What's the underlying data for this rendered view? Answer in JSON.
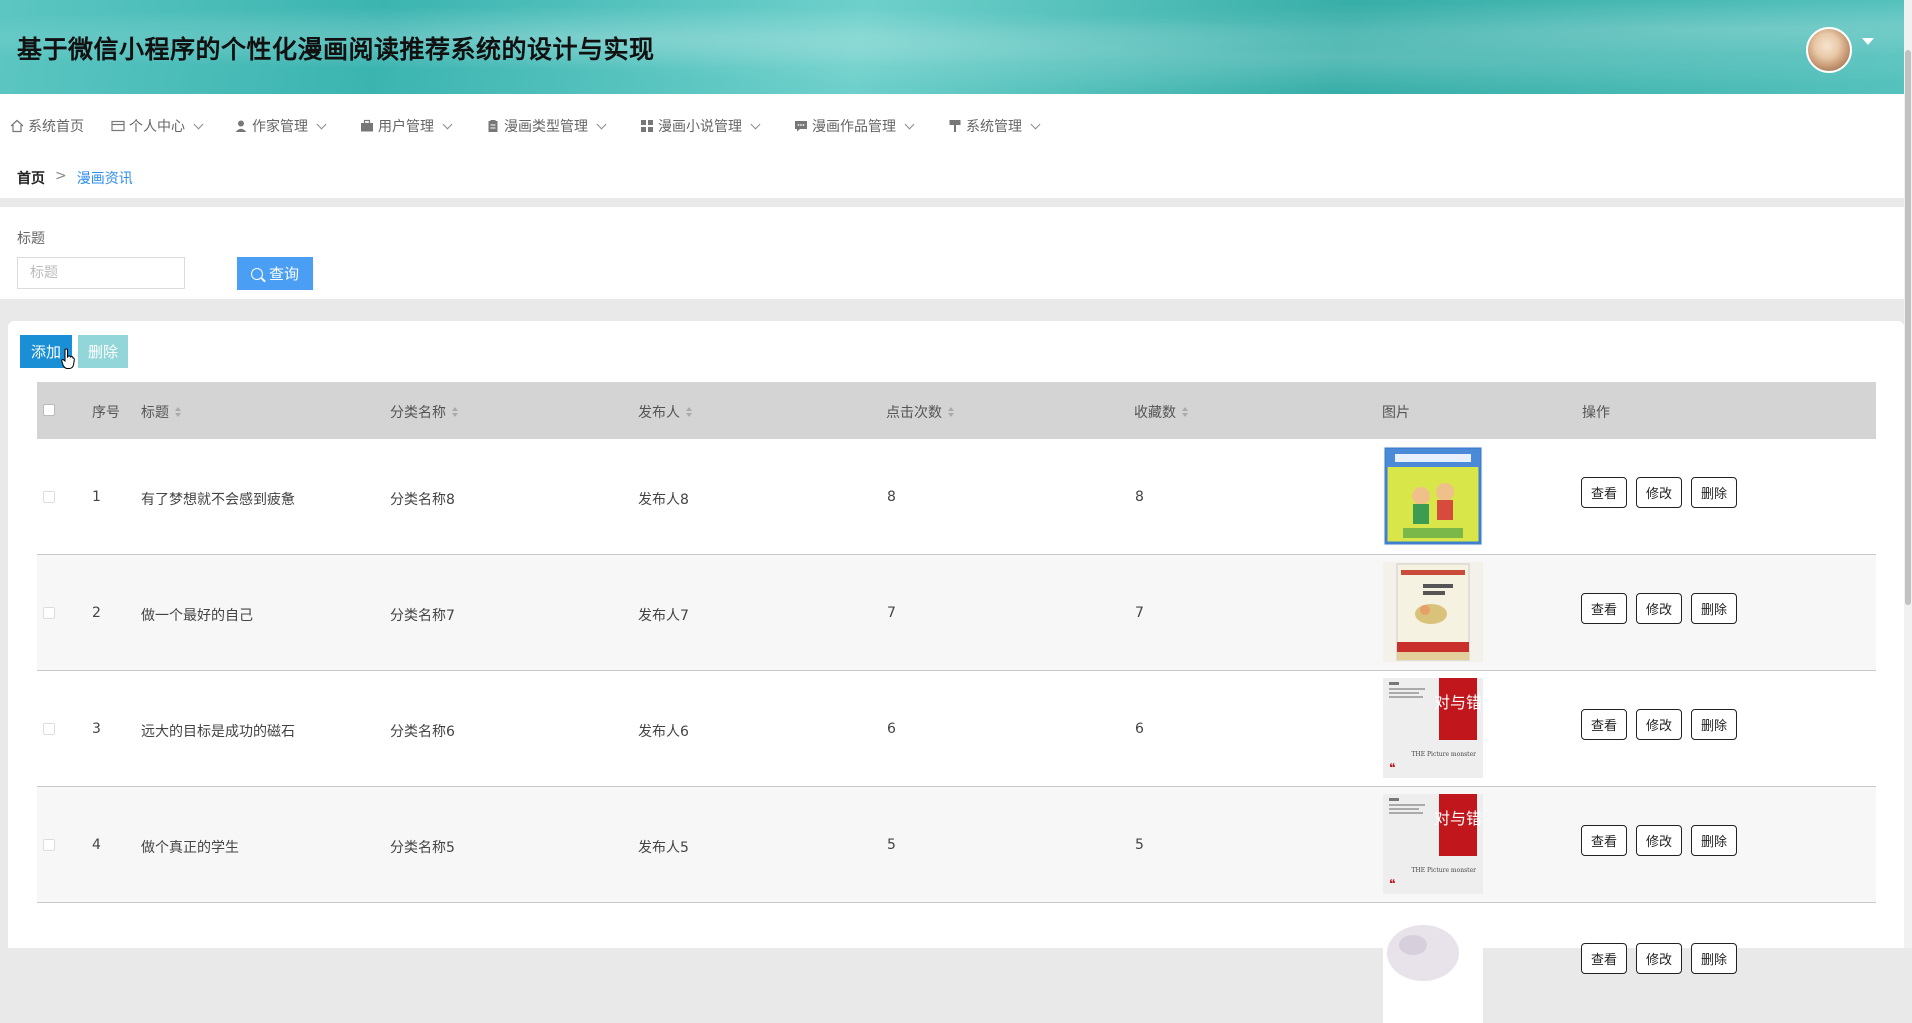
{
  "header": {
    "title": "基于微信小程序的个性化漫画阅读推荐系统的设计与实现"
  },
  "nav": {
    "items": [
      {
        "label": "系统首页",
        "icon": "home-icon"
      },
      {
        "label": "个人中心",
        "icon": "id-card-icon"
      },
      {
        "label": "作家管理",
        "icon": "user-icon"
      },
      {
        "label": "用户管理",
        "icon": "briefcase-icon"
      },
      {
        "label": "漫画类型管理",
        "icon": "clipboard-icon"
      },
      {
        "label": "漫画小说管理",
        "icon": "grid-icon"
      },
      {
        "label": "漫画作品管理",
        "icon": "chat-icon"
      },
      {
        "label": "系统管理",
        "icon": "paint-roller-icon"
      }
    ]
  },
  "breadcrumb": {
    "home": "首页",
    "sep": ">",
    "current": "漫画资讯"
  },
  "search": {
    "label": "标题",
    "placeholder": "标题",
    "button": "查询"
  },
  "toolbar": {
    "add": "添加",
    "delete": "删除"
  },
  "table": {
    "columns": [
      "序号",
      "标题",
      "分类名称",
      "发布人",
      "点击次数",
      "收藏数",
      "图片",
      "操作"
    ],
    "actions": {
      "view": "查看",
      "edit": "修改",
      "delete": "删除"
    },
    "rows": [
      {
        "no": "1",
        "title": "有了梦想就不会感到疲惫",
        "category": "分类名称8",
        "publisher": "发布人8",
        "clicks": "8",
        "favorites": "8"
      },
      {
        "no": "2",
        "title": "做一个最好的自己",
        "category": "分类名称7",
        "publisher": "发布人7",
        "clicks": "7",
        "favorites": "7"
      },
      {
        "no": "3",
        "title": "远大的目标是成功的磁石",
        "category": "分类名称6",
        "publisher": "发布人6",
        "clicks": "6",
        "favorites": "6"
      },
      {
        "no": "4",
        "title": "做个真正的学生",
        "category": "分类名称5",
        "publisher": "发布人5",
        "clicks": "5",
        "favorites": "5"
      }
    ],
    "cover_text": {
      "red_title": "对与错",
      "sub": "THE Picture monster"
    }
  },
  "colors": {
    "accent": "#1a8fd6",
    "search_button": "#4a9ff5",
    "link": "#2d8cf0",
    "header": "#3bb4b0"
  }
}
